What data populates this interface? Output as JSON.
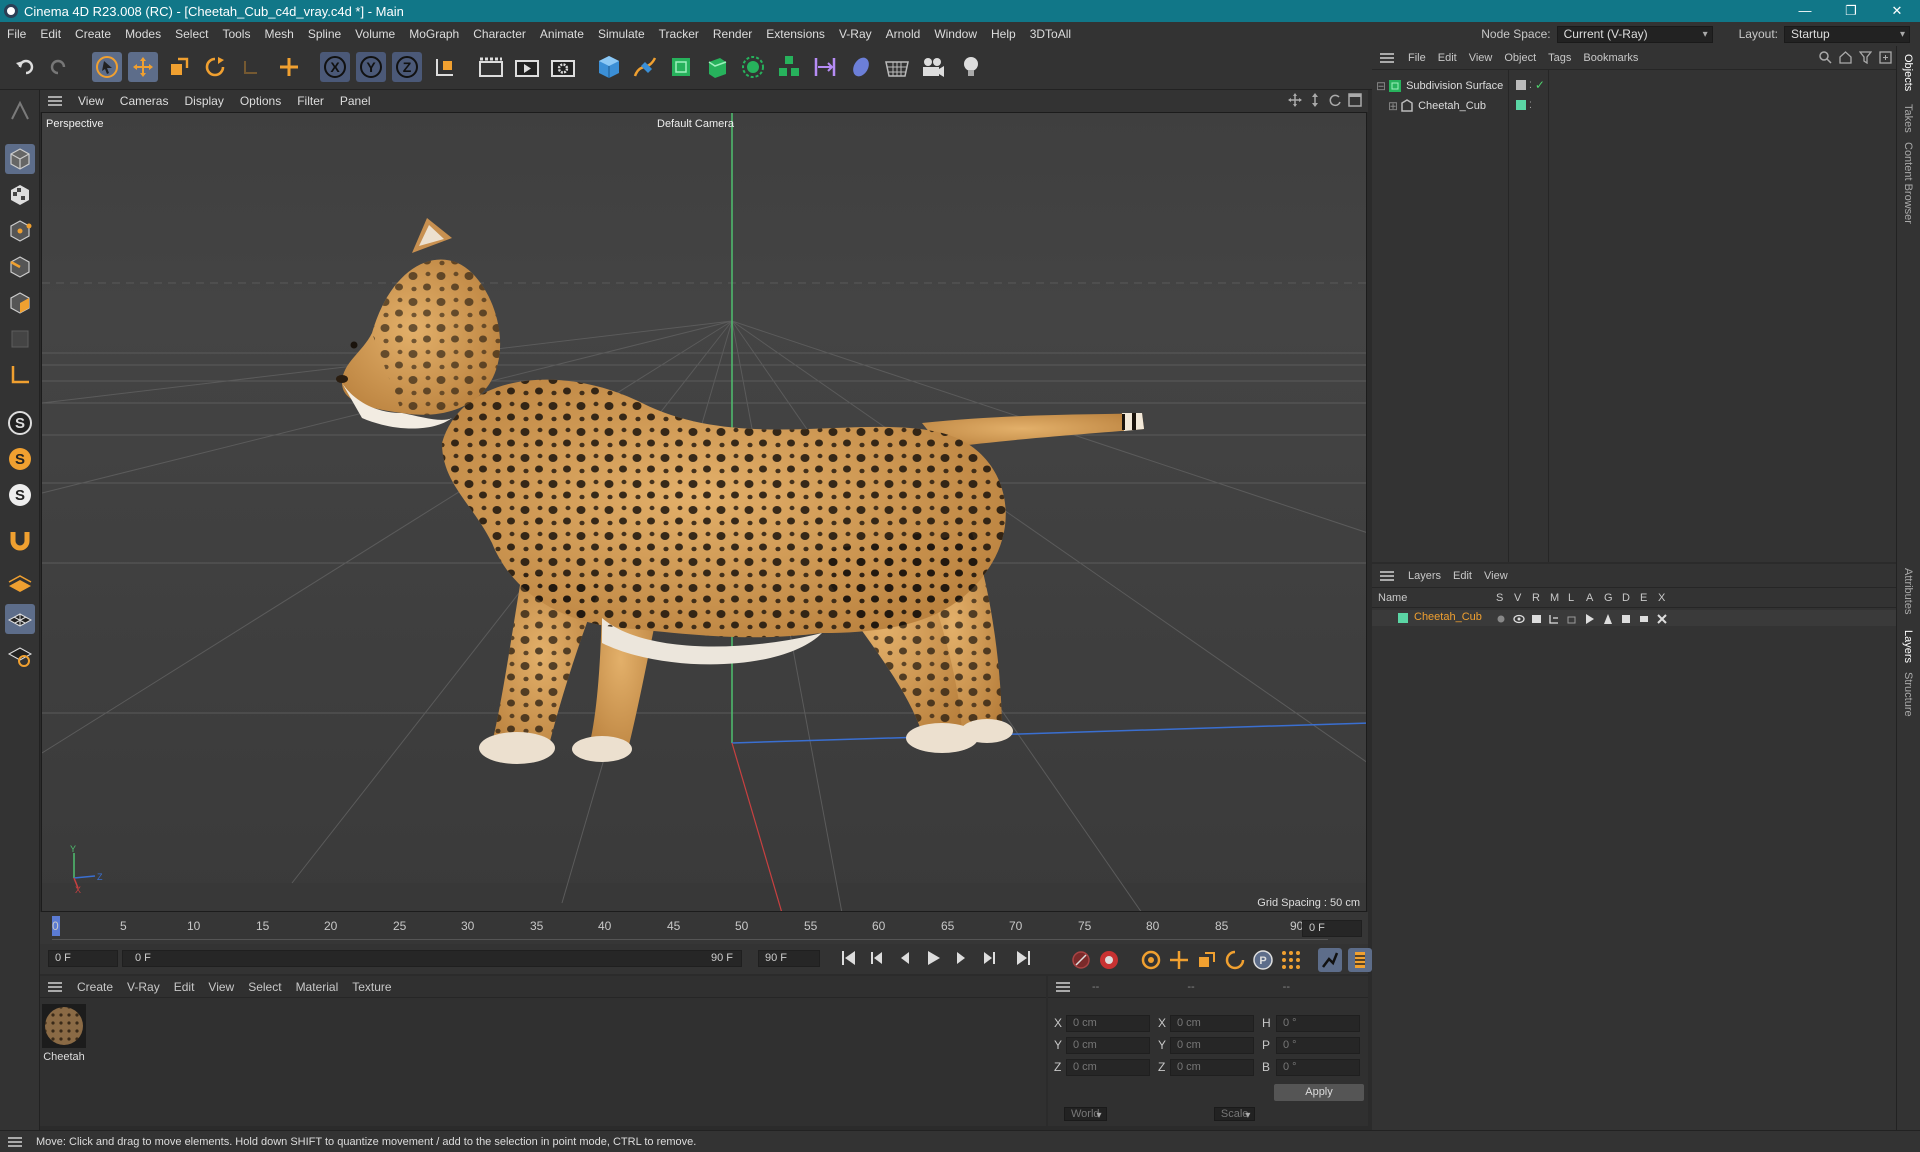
{
  "titlebar": {
    "title": "Cinema 4D R23.008 (RC) - [Cheetah_Cub_c4d_vray.c4d *] - Main",
    "minimize": "—",
    "restore": "❐",
    "close": "✕"
  },
  "menubar": {
    "items": [
      "File",
      "Edit",
      "Create",
      "Modes",
      "Select",
      "Tools",
      "Mesh",
      "Spline",
      "Volume",
      "MoGraph",
      "Character",
      "Animate",
      "Simulate",
      "Tracker",
      "Render",
      "Extensions",
      "V-Ray",
      "Arnold",
      "Window",
      "Help",
      "3DToAll"
    ],
    "node_space_label": "Node Space:",
    "node_space_value": "Current (V-Ray)",
    "layout_label": "Layout:",
    "layout_value": "Startup"
  },
  "viewport": {
    "menu": [
      "View",
      "Cameras",
      "Display",
      "Options",
      "Filter",
      "Panel"
    ],
    "view_name": "Perspective",
    "camera": "Default Camera",
    "grid_spacing": "Grid Spacing : 50 cm",
    "axis_y": "Y",
    "axis_z": "Z",
    "axis_x": "X"
  },
  "timeline": {
    "ticks": [
      "0",
      "5",
      "10",
      "15",
      "20",
      "25",
      "30",
      "35",
      "40",
      "45",
      "50",
      "55",
      "60",
      "65",
      "70",
      "75",
      "80",
      "85",
      "90"
    ],
    "current_frame": "0 F",
    "start_frame": "0 F",
    "range_start": "0 F",
    "range_end": "90 F",
    "end_frame": "90 F"
  },
  "material_manager": {
    "menu": [
      "Create",
      "V-Ray",
      "Edit",
      "View",
      "Select",
      "Material",
      "Texture"
    ],
    "materials": [
      {
        "name": "Cheetah"
      }
    ]
  },
  "coordinates": {
    "headers": [
      "--",
      "--",
      "--"
    ],
    "rows": [
      {
        "a": "X",
        "av": "0 cm",
        "b": "X",
        "bv": "0 cm",
        "c": "H",
        "cv": "0 °"
      },
      {
        "a": "Y",
        "av": "0 cm",
        "b": "Y",
        "bv": "0 cm",
        "c": "P",
        "cv": "0 °"
      },
      {
        "a": "Z",
        "av": "0 cm",
        "b": "Z",
        "bv": "0 cm",
        "c": "B",
        "cv": "0 °"
      }
    ],
    "space": "World",
    "mode": "Scale",
    "apply": "Apply"
  },
  "object_manager": {
    "menu": [
      "File",
      "Edit",
      "View",
      "Object",
      "Tags",
      "Bookmarks"
    ],
    "objects": [
      {
        "name": "Subdivision Surface",
        "color": "#cfcfcf"
      },
      {
        "name": "Cheetah_Cub",
        "color": "#cfcfcf"
      }
    ]
  },
  "layer_manager": {
    "menu": [
      "Layers",
      "Edit",
      "View"
    ],
    "columns": [
      "Name",
      "S",
      "V",
      "R",
      "M",
      "L",
      "A",
      "G",
      "D",
      "E",
      "X"
    ],
    "layers": [
      {
        "name": "Cheetah_Cub",
        "color": "#5bd6a5"
      }
    ]
  },
  "side_tabs": [
    "Objects",
    "Takes",
    "Content Browser",
    "Attributes",
    "Layers",
    "Structure"
  ],
  "status": "Move: Click and drag to move elements. Hold down SHIFT to quantize movement / add to the selection in point mode, CTRL to remove.",
  "colors": {
    "accent": "#117788",
    "orange": "#f0a030",
    "selection": "#5d6d8a",
    "layer_green": "#5bd6a5"
  }
}
